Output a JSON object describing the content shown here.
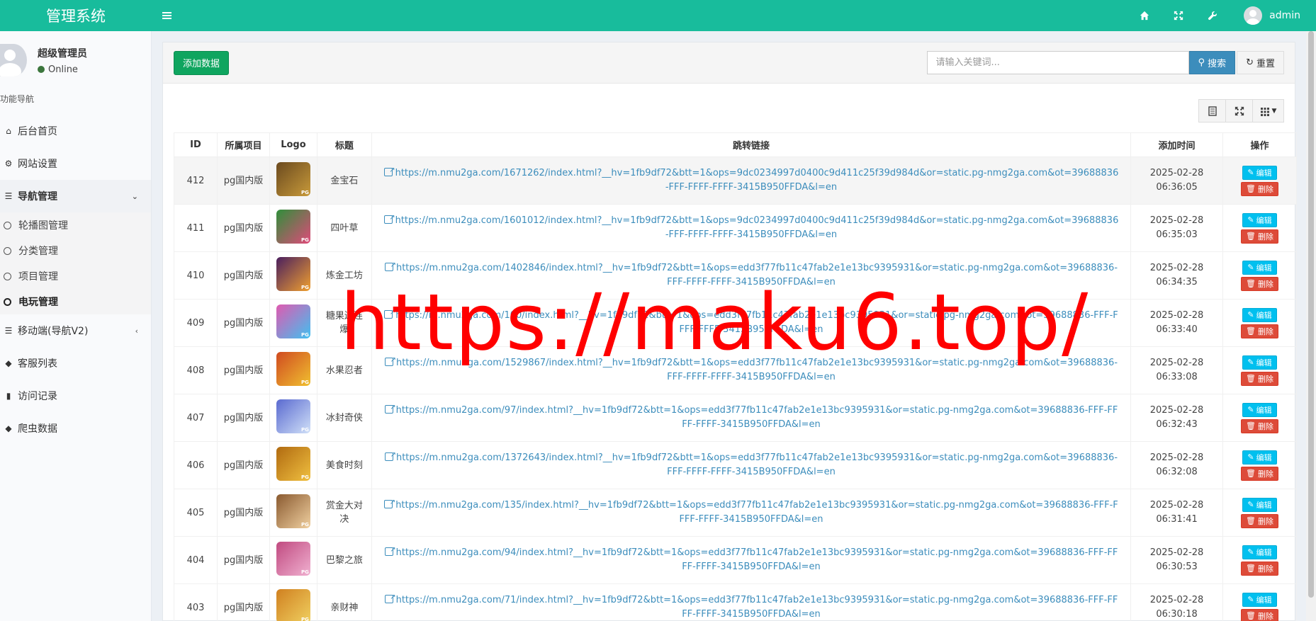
{
  "header": {
    "brand": "管理系统",
    "username": "admin",
    "icons": [
      "home-icon",
      "expand-icon",
      "wrench-icon"
    ]
  },
  "sidebar": {
    "user_name": "超级管理员",
    "user_status": "Online",
    "nav_header": "功能导航",
    "items": [
      {
        "label": "后台首页",
        "icon": "home-icon"
      },
      {
        "label": "网站设置",
        "icon": "cogs-icon"
      },
      {
        "label": "导航管理",
        "icon": "database-icon"
      },
      {
        "label": "移动端(导航V2)",
        "icon": "database-icon"
      },
      {
        "label": "客服列表",
        "icon": "tags-icon"
      },
      {
        "label": "访问记录",
        "icon": "bar-chart-icon"
      },
      {
        "label": "爬虫数据",
        "icon": "tags-icon"
      }
    ],
    "subitems": [
      {
        "label": "轮播图管理"
      },
      {
        "label": "分类管理"
      },
      {
        "label": "项目管理"
      },
      {
        "label": "电玩管理"
      }
    ]
  },
  "toolbar": {
    "add_label": "添加数据",
    "search_placeholder": "请输入关键词...",
    "search_label": "搜索",
    "reset_label": "重置"
  },
  "table": {
    "headers": [
      "ID",
      "所属项目",
      "Logo",
      "标题",
      "跳转链接",
      "添加时间",
      "操作"
    ],
    "edit_label": "编辑",
    "delete_label": "删除",
    "rows": [
      {
        "id": "412",
        "project": "pg国内版",
        "title": "金宝石",
        "link": "https://m.nmu2ga.com/1671262/index.html?__hv=1fb9df72&btt=1&ops=9dc0234997d0400c9d411c25f39d984d&or=static.pg-nmg2ga.com&ot=39688836-FFF-FFFF-FFFF-3415B950FFDA&l=en",
        "date": "2025-02-28",
        "time": "06:36:05",
        "color1": "#6b4a1f",
        "color2": "#c89a3a"
      },
      {
        "id": "411",
        "project": "pg国内版",
        "title": "四叶草",
        "link": "https://m.nmu2ga.com/1601012/index.html?__hv=1fb9df72&btt=1&ops=9dc0234997d0400c9d411c25f39d984d&or=static.pg-nmg2ga.com&ot=39688836-FFF-FFFF-FFFF-3415B950FFDA&l=en",
        "date": "2025-02-28",
        "time": "06:35:03",
        "color1": "#2f8f3a",
        "color2": "#e04a7a"
      },
      {
        "id": "410",
        "project": "pg国内版",
        "title": "炼金工坊",
        "link": "https://m.nmu2ga.com/1402846/index.html?__hv=1fb9df72&btt=1&ops=edd3f77fb11c47fab2e1e13bc9395931&or=static.pg-nmg2ga.com&ot=39688836-FFF-FFFF-FFFF-3415B950FFDA&l=en",
        "date": "2025-02-28",
        "time": "06:34:35",
        "color1": "#4a1f5e",
        "color2": "#f0a030"
      },
      {
        "id": "409",
        "project": "pg国内版",
        "title": "糖果连连爆",
        "link": "https://m.nmu2ga.com/100/index.html?__hv=1fb9df72&btt=1&ops=edd3f77fb11c47fab2e1e13bc9395931&or=static.pg-nmg2ga.com&ot=39688836-FFF-FFFF-FFFF-3415B950FFDA&l=en",
        "date": "2025-02-28",
        "time": "06:33:40",
        "color1": "#e05ab0",
        "color2": "#40c0f0"
      },
      {
        "id": "408",
        "project": "pg国内版",
        "title": "水果忍者",
        "link": "https://m.nmu2ga.com/1529867/index.html?__hv=1fb9df72&btt=1&ops=edd3f77fb11c47fab2e1e13bc9395931&or=static.pg-nmg2ga.com&ot=39688836-FFF-FFFF-FFFF-3415B950FFDA&l=en",
        "date": "2025-02-28",
        "time": "06:33:08",
        "color1": "#d04a20",
        "color2": "#f0c030"
      },
      {
        "id": "407",
        "project": "pg国内版",
        "title": "冰封奇侠",
        "link": "https://m.nmu2ga.com/97/index.html?__hv=1fb9df72&btt=1&ops=edd3f77fb11c47fab2e1e13bc9395931&or=static.pg-nmg2ga.com&ot=39688836-FFF-FFFF-FFFF-3415B950FFDA&l=en",
        "date": "2025-02-28",
        "time": "06:32:43",
        "color1": "#5a6ad0",
        "color2": "#d0e0f8"
      },
      {
        "id": "406",
        "project": "pg国内版",
        "title": "美食时刻",
        "link": "https://m.nmu2ga.com/1372643/index.html?__hv=1fb9df72&btt=1&ops=edd3f77fb11c47fab2e1e13bc9395931&or=static.pg-nmg2ga.com&ot=39688836-FFF-FFFF-FFFF-3415B950FFDA&l=en",
        "date": "2025-02-28",
        "time": "06:32:08",
        "color1": "#b06a10",
        "color2": "#f0c040"
      },
      {
        "id": "405",
        "project": "pg国内版",
        "title": "赏金大对决",
        "link": "https://m.nmu2ga.com/135/index.html?__hv=1fb9df72&btt=1&ops=edd3f77fb11c47fab2e1e13bc9395931&or=static.pg-nmg2ga.com&ot=39688836-FFF-FFFF-FFFF-3415B950FFDA&l=en",
        "date": "2025-02-28",
        "time": "06:31:41",
        "color1": "#8a5a30",
        "color2": "#f0d0a0"
      },
      {
        "id": "404",
        "project": "pg国内版",
        "title": "巴黎之旅",
        "link": "https://m.nmu2ga.com/94/index.html?__hv=1fb9df72&btt=1&ops=edd3f77fb11c47fab2e1e13bc9395931&or=static.pg-nmg2ga.com&ot=39688836-FFF-FFFF-FFFF-3415B950FFDA&l=en",
        "date": "2025-02-28",
        "time": "06:30:53",
        "color1": "#c04a80",
        "color2": "#f0b0d0"
      },
      {
        "id": "403",
        "project": "pg国内版",
        "title": "亲财神",
        "link": "https://m.nmu2ga.com/71/index.html?__hv=1fb9df72&btt=1&ops=edd3f77fb11c47fab2e1e13bc9395931&or=static.pg-nmg2ga.com&ot=39688836-FFF-FFFF-FFFF-3415B950FFDA&l=en",
        "date": "2025-02-28",
        "time": "06:30:18",
        "color1": "#d08020",
        "color2": "#f0d060"
      }
    ]
  },
  "watermark": "https://maku6.top/"
}
